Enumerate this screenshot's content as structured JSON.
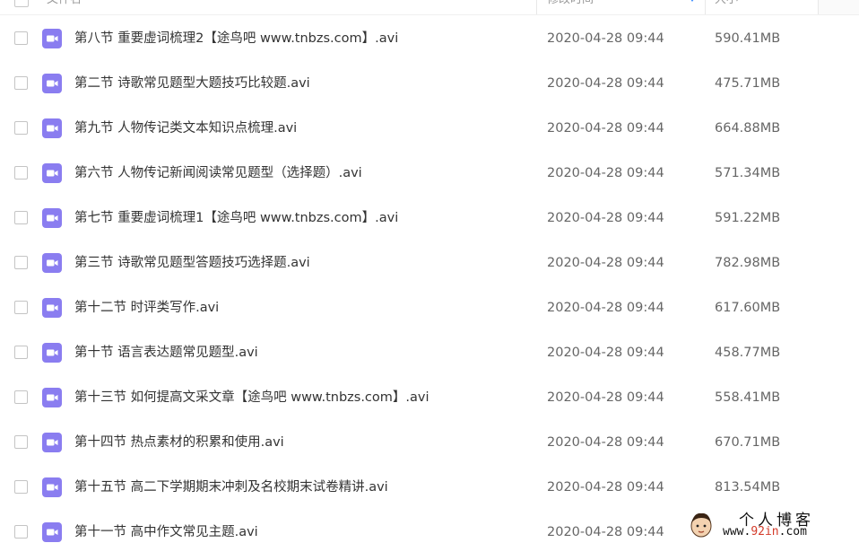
{
  "header": {
    "name_label": "文件名",
    "modified_label": "修改时间",
    "size_label": "大小"
  },
  "files": [
    {
      "name": "第八节 重要虚词梳理2【途鸟吧 www.tnbzs.com】.avi",
      "modified": "2020-04-28 09:44",
      "size": "590.41MB"
    },
    {
      "name": "第二节 诗歌常见题型大题技巧比较题.avi",
      "modified": "2020-04-28 09:44",
      "size": "475.71MB"
    },
    {
      "name": "第九节 人物传记类文本知识点梳理.avi",
      "modified": "2020-04-28 09:44",
      "size": "664.88MB"
    },
    {
      "name": "第六节 人物传记新闻阅读常见题型（选择题）.avi",
      "modified": "2020-04-28 09:44",
      "size": "571.34MB"
    },
    {
      "name": "第七节 重要虚词梳理1【途鸟吧 www.tnbzs.com】.avi",
      "modified": "2020-04-28 09:44",
      "size": "591.22MB"
    },
    {
      "name": "第三节 诗歌常见题型答题技巧选择题.avi",
      "modified": "2020-04-28 09:44",
      "size": "782.98MB"
    },
    {
      "name": "第十二节 时评类写作.avi",
      "modified": "2020-04-28 09:44",
      "size": "617.60MB"
    },
    {
      "name": "第十节 语言表达题常见题型.avi",
      "modified": "2020-04-28 09:44",
      "size": "458.77MB"
    },
    {
      "name": "第十三节 如何提高文采文章【途鸟吧 www.tnbzs.com】.avi",
      "modified": "2020-04-28 09:44",
      "size": "558.41MB"
    },
    {
      "name": "第十四节 热点素材的积累和使用.avi",
      "modified": "2020-04-28 09:44",
      "size": "670.71MB"
    },
    {
      "name": "第十五节 高二下学期期末冲刺及名校期末试卷精讲.avi",
      "modified": "2020-04-28 09:44",
      "size": "813.54MB"
    },
    {
      "name": "第十一节 高中作文常见主题.avi",
      "modified": "2020-04-28 09:44",
      "size": ""
    }
  ],
  "icons": {
    "file_type": "video-file-icon",
    "sort": "sort-caret-icon"
  },
  "colors": {
    "video_icon": "#8a7df0",
    "sort_accent": "#3b8cff"
  },
  "watermark": {
    "title": "个人博客",
    "url_prefix": "www.",
    "url_highlight": "92in",
    "url_suffix": ".com"
  }
}
